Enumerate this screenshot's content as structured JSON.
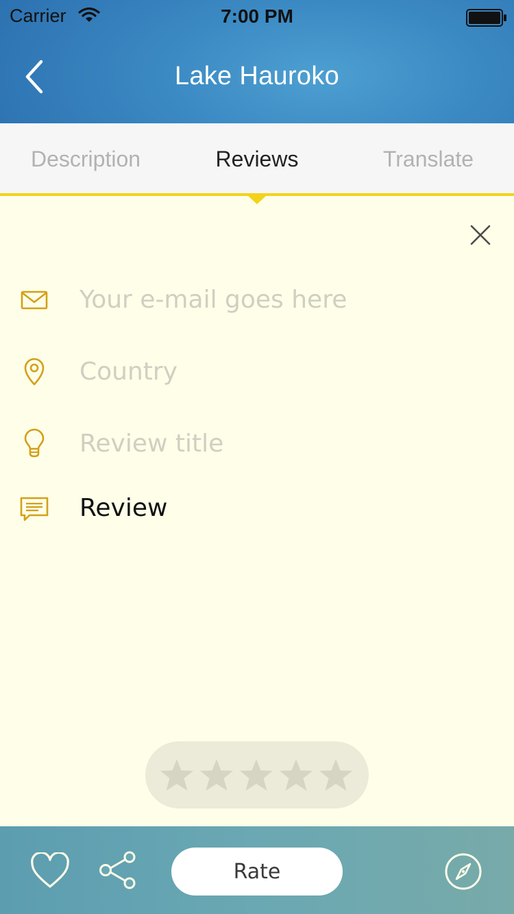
{
  "status_bar": {
    "carrier": "Carrier",
    "time": "7:00 PM"
  },
  "header": {
    "title": "Lake Hauroko"
  },
  "tabs": [
    {
      "label": "Description",
      "active": false
    },
    {
      "label": "Reviews",
      "active": true
    },
    {
      "label": "Translate",
      "active": false
    }
  ],
  "form": {
    "email": {
      "placeholder": "Your e-mail goes here",
      "value": "",
      "icon": "envelope-icon"
    },
    "country": {
      "placeholder": "Country",
      "value": "",
      "icon": "map-pin-icon"
    },
    "review_title": {
      "placeholder": "Review title",
      "value": "",
      "icon": "lightbulb-icon"
    },
    "review": {
      "placeholder": "",
      "value": "Review",
      "icon": "speech-bubble-icon"
    }
  },
  "rating": {
    "max_stars": 5,
    "selected": 0
  },
  "bottom_bar": {
    "rate_label": "Rate"
  },
  "colors": {
    "header_blue": "#3b89c3",
    "tab_indicator": "#f3d319",
    "page_background": "#fefee9",
    "icon_gold": "#d4a017",
    "star_grey": "#d6d4c3",
    "bottom_bar_teal": "#6aa8b3"
  }
}
